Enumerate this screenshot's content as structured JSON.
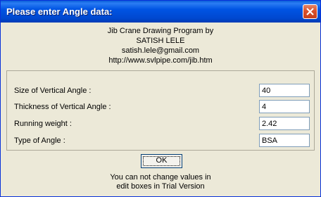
{
  "window": {
    "title": "Please enter Angle data:"
  },
  "header": {
    "line1": "Jib Crane Drawing Program by",
    "line2": "SATISH LELE",
    "line3": "satish.lele@gmail.com",
    "line4": "http://www.svlpipe.com/jib.htm"
  },
  "fields": [
    {
      "label": "Size of Vertical Angle :",
      "value": "40"
    },
    {
      "label": "Thickness of Vertical Angle :",
      "value": "4"
    },
    {
      "label": "Running weight :",
      "value": "2.42"
    },
    {
      "label": "Type of Angle :",
      "value": "BSA"
    }
  ],
  "ok_label": "OK",
  "notice": {
    "line1": "You can not change values in",
    "line2": "edit boxes in Trial Version"
  },
  "icons": {
    "close": "close-icon"
  },
  "colors": {
    "titlebar": "#0054e3",
    "close_button": "#d9502b",
    "dialog_bg": "#ece9d8"
  }
}
